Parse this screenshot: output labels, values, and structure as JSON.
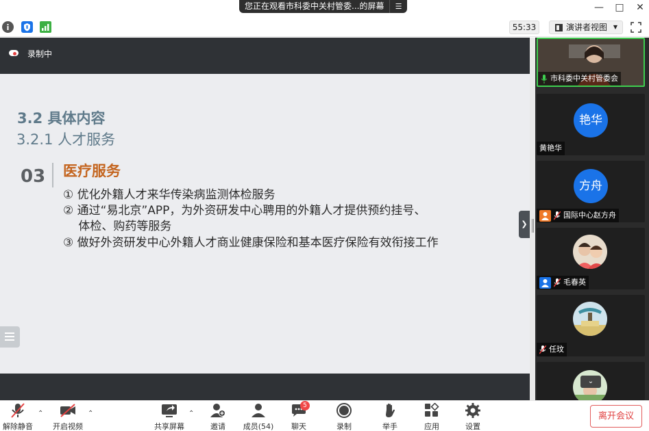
{
  "banner": {
    "text": "您正在观看市科委中关村管委...的屏幕",
    "menu_icon": "menu-icon"
  },
  "window": {
    "minimize": "—",
    "maximize": "□",
    "close": "✕"
  },
  "toolbar": {
    "timer": "55:33",
    "view_label": "演讲者视图",
    "colors": {
      "info": "#555555",
      "shield": "#1a73e8",
      "signal": "#3cb043"
    }
  },
  "recording": {
    "label": "录制中"
  },
  "slide": {
    "title": "3.2 具体内容",
    "subtitle": "3.2.1 人才服务",
    "number": "03",
    "heading": "医疗服务",
    "items": [
      "① 优化外籍人才来华传染病监测体检服务",
      "② 通过“易北京”APP，为外资研发中心聘用的外籍人才提供预约挂号、",
      "　 体检、购药等服务",
      "③ 做好外资研发中心外籍人才商业健康保险和基本医疗保险有效衔接工作"
    ],
    "colors": {
      "title": "#5f7a8a",
      "heading": "#c4651f"
    }
  },
  "participants": [
    {
      "name": "市科委中关村管委会",
      "type": "video"
    },
    {
      "name": "黄艳华",
      "avatar_text": "艳华",
      "type": "avatar"
    },
    {
      "name": "国际中心赵方舟",
      "avatar_text": "方舟",
      "type": "avatar"
    },
    {
      "name": "毛春英",
      "type": "photo"
    },
    {
      "name": "任玟",
      "type": "photo"
    }
  ],
  "bottombar": {
    "unmute": "解除静音",
    "start_video": "开启视频",
    "share": "共享屏幕",
    "invite": "邀请",
    "members": "成员(54)",
    "chat": "聊天",
    "chat_badge": "5",
    "record": "录制",
    "raise_hand": "举手",
    "apps": "应用",
    "settings": "设置",
    "leave": "离开会议"
  }
}
